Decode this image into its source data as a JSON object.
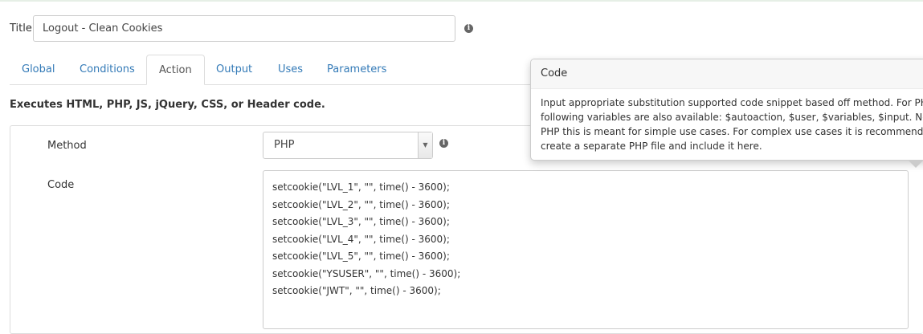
{
  "title_field": {
    "label": "Title",
    "value": "Logout - Clean Cookies"
  },
  "tabs": [
    {
      "label": "Global"
    },
    {
      "label": "Conditions"
    },
    {
      "label": "Action"
    },
    {
      "label": "Output"
    },
    {
      "label": "Uses"
    },
    {
      "label": "Parameters"
    }
  ],
  "active_tab": "Action",
  "description": "Executes HTML, PHP, JS, jQuery, CSS, or Header code.",
  "method": {
    "label": "Method",
    "value": "PHP"
  },
  "code": {
    "label": "Code",
    "lines": [
      "setcookie(\"LVL_1\", \"\", time() - 3600);",
      "setcookie(\"LVL_2\", \"\", time() - 3600);",
      "setcookie(\"LVL_3\", \"\", time() - 3600);",
      "setcookie(\"LVL_4\", \"\", time() - 3600);",
      "setcookie(\"LVL_5\", \"\", time() - 3600);",
      "setcookie(\"YSUSER\", \"\", time() - 3600);",
      "setcookie(\"JWT\", \"\", time() - 3600);"
    ]
  },
  "popover": {
    "title": "Code",
    "lines": [
      "Input appropriate substitution supported code snippet based off method. For PHP",
      "following variables are also available: $autoaction, $user, $variables, $input. Note",
      "PHP this is meant for simple use cases. For complex use cases it is recommended",
      "create a separate PHP file and include it here."
    ]
  },
  "colors": {
    "link": "#337ab7",
    "border": "#dddddd"
  }
}
